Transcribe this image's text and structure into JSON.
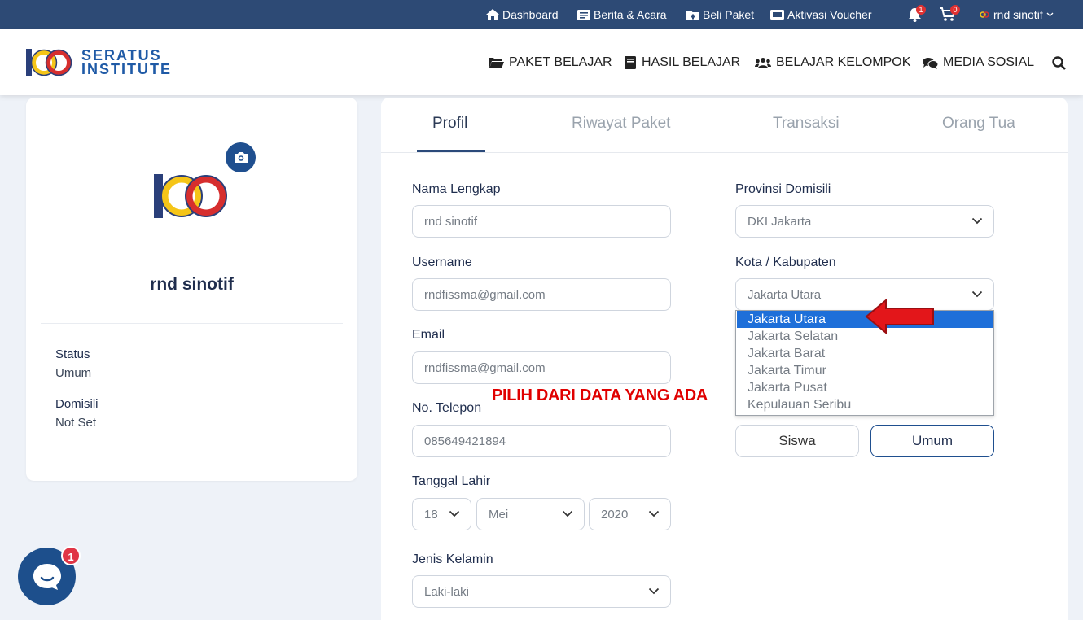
{
  "topbar": {
    "dashboard": "Dashboard",
    "berita": "Berita & Acara",
    "beli": "Beli Paket",
    "voucher": "Aktivasi Voucher",
    "notif_count": "1",
    "cart_count": "0",
    "user": "rnd sinotif"
  },
  "brand": {
    "line1": "SERATUS",
    "line2": "INSTITUTE"
  },
  "nav": {
    "paket": "PAKET BELAJAR",
    "hasil": "HASIL BELAJAR",
    "kelompok": "BELAJAR KELOMPOK",
    "media": "MEDIA SOSIAL"
  },
  "profile": {
    "name": "rnd sinotif",
    "status_label": "Status",
    "status_value": "Umum",
    "domisili_label": "Domisili",
    "domisili_value": "Not Set"
  },
  "tabs": [
    "Profil",
    "Riwayat Paket",
    "Transaksi",
    "Orang Tua"
  ],
  "form": {
    "nama_label": "Nama Lengkap",
    "nama_value": "rnd sinotif",
    "username_label": "Username",
    "username_value": "rndfissma@gmail.com",
    "email_label": "Email",
    "email_value": "rndfissma@gmail.com",
    "telp_label": "No. Telepon",
    "telp_value": "085649421894",
    "tgl_label": "Tanggal Lahir",
    "tgl_day": "18",
    "tgl_month": "Mei",
    "tgl_year": "2020",
    "gender_label": "Jenis Kelamin",
    "gender_value": "Laki-laki",
    "provinsi_label": "Provinsi Domisili",
    "provinsi_value": "DKI Jakarta",
    "kota_label": "Kota / Kabupaten",
    "kota_value": "Jakarta Utara",
    "kota_options": [
      "Jakarta Utara",
      "Jakarta Selatan",
      "Jakarta Barat",
      "Jakarta Timur",
      "Jakarta Pusat",
      "Kepulauan Seribu"
    ],
    "siswa_label": "Siswa",
    "umum_label": "Umum"
  },
  "annotation": "PILIH DARI DATA YANG ADA",
  "chat_badge": "1",
  "colors": {
    "topbar": "#2d4a75",
    "primary": "#1f4f8f",
    "selected": "#1e6fd9",
    "annotation": "#e00000",
    "brand_red": "#d62e2e",
    "brand_yellow": "#f5c518"
  }
}
